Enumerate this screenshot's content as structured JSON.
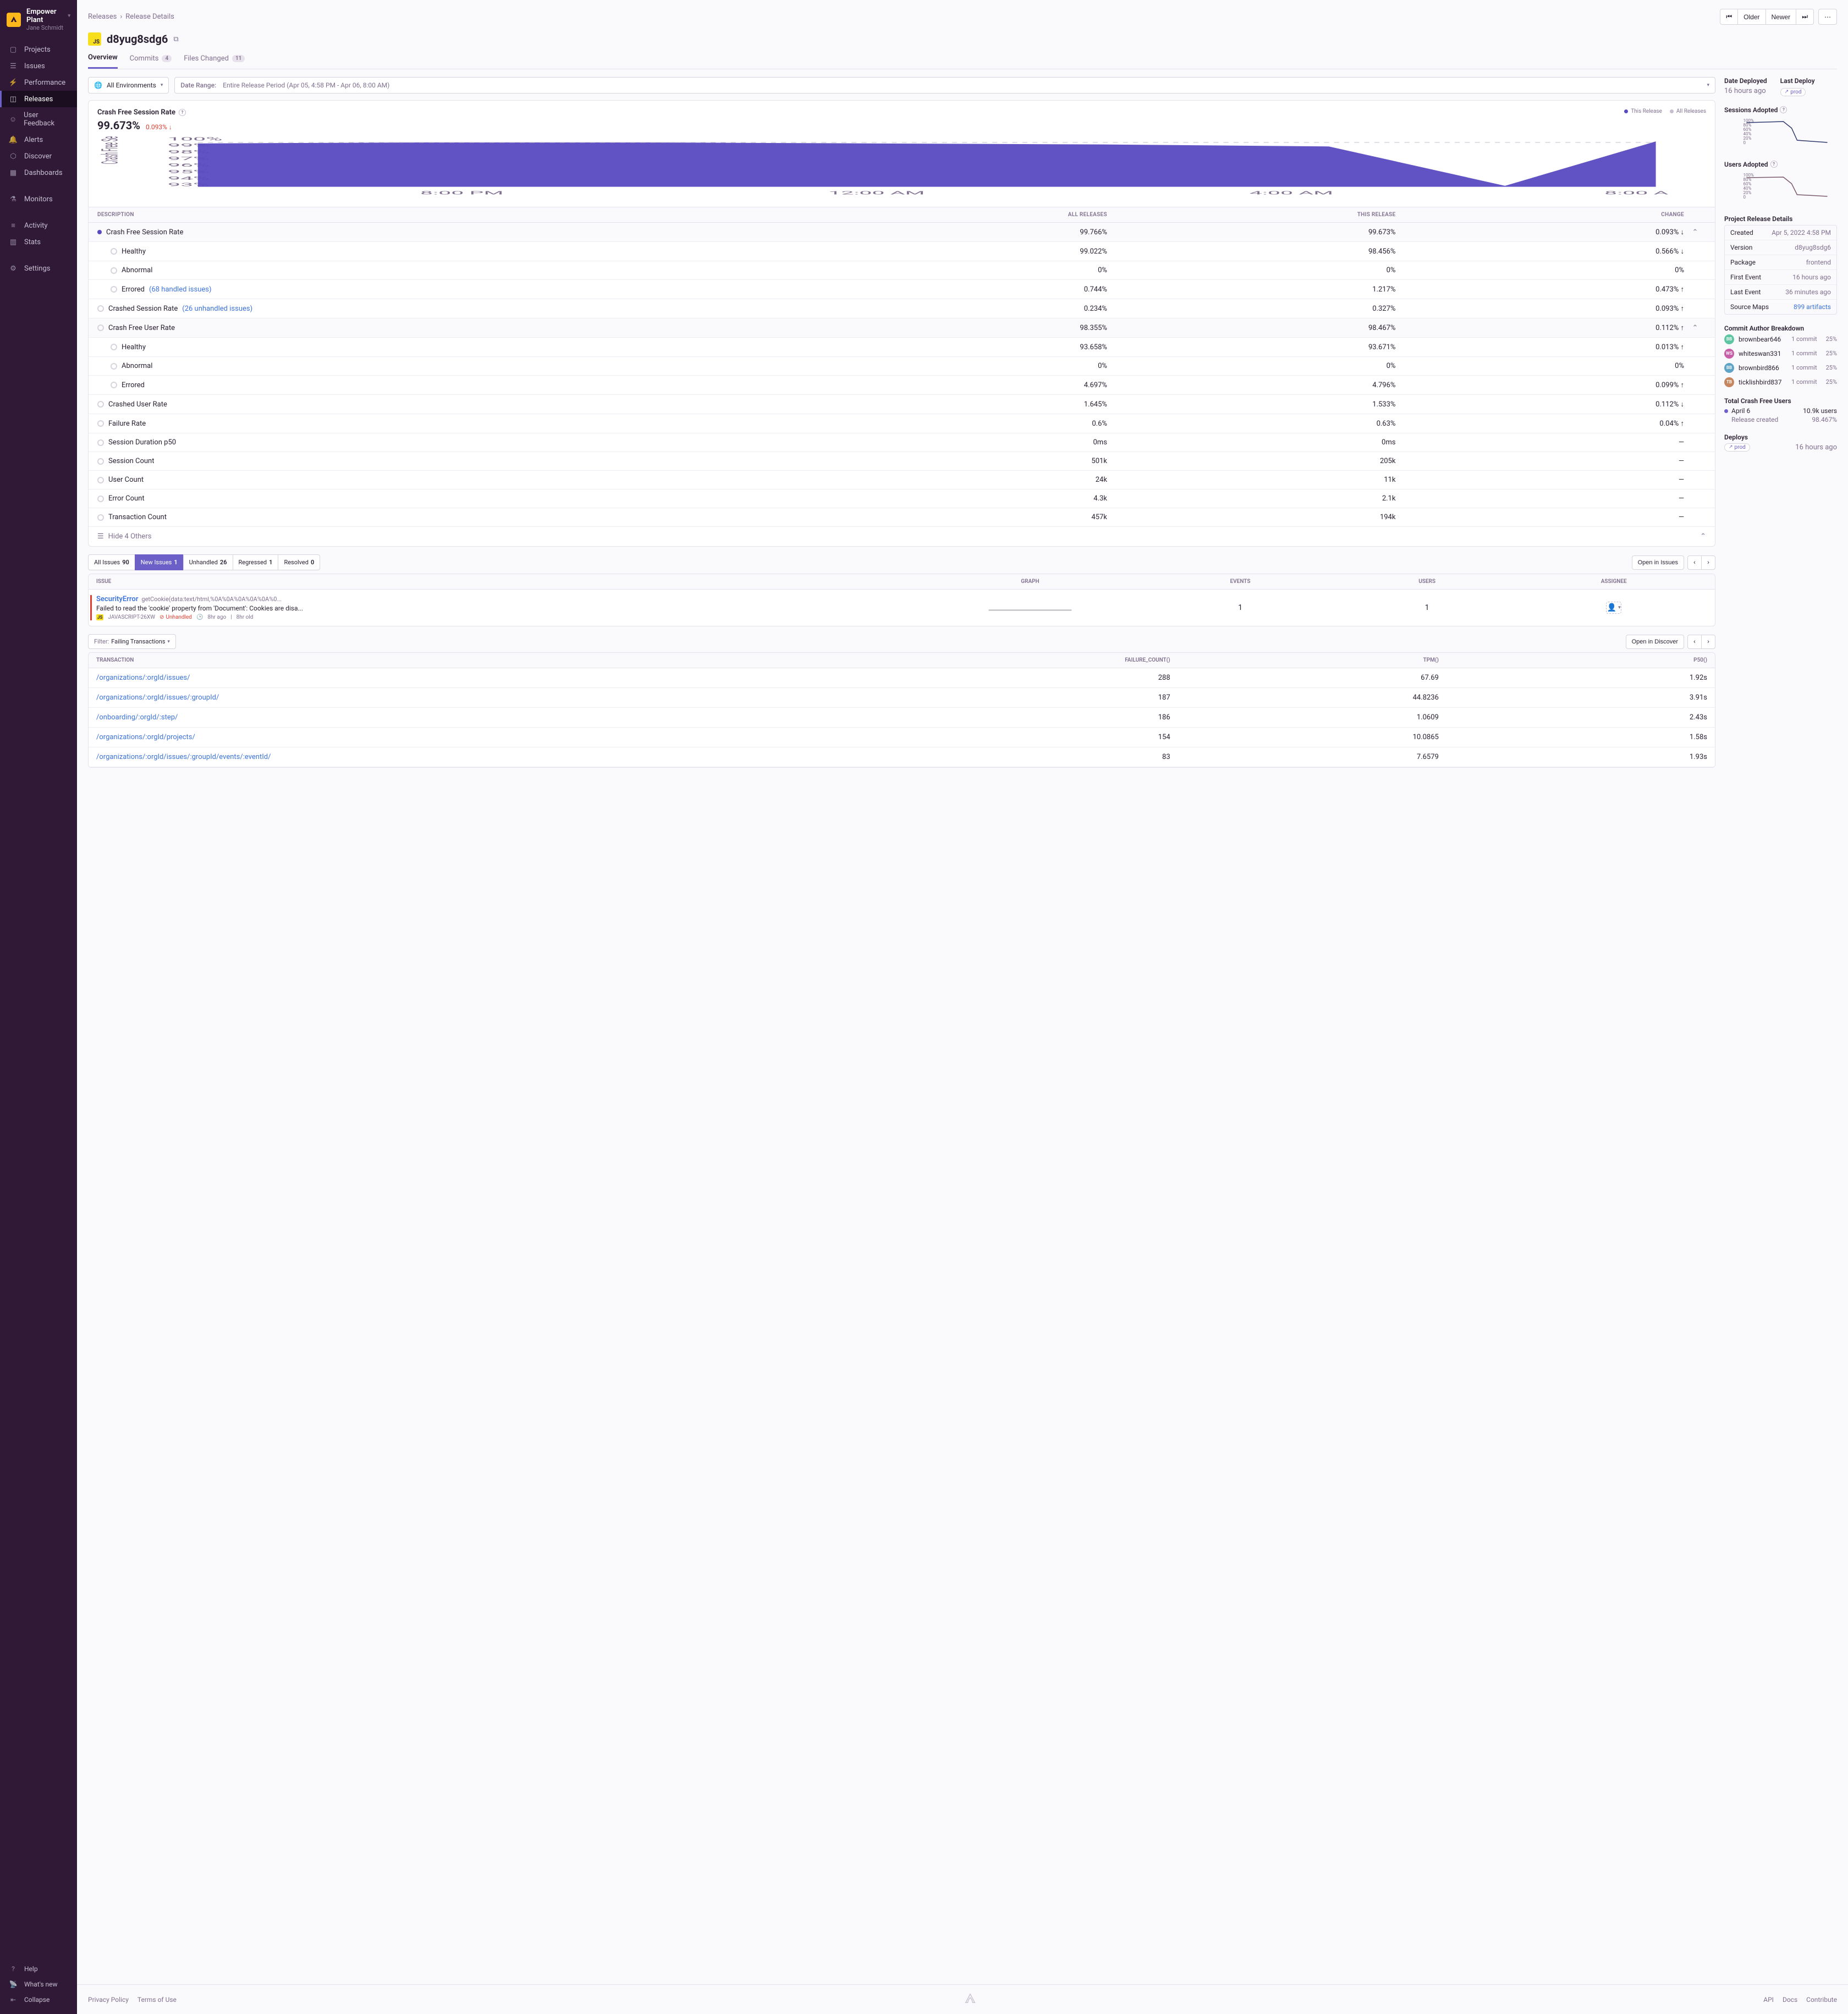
{
  "org": {
    "name": "Empower Plant",
    "user": "Jane Schmidt"
  },
  "nav": {
    "items": [
      "Projects",
      "Issues",
      "Performance",
      "Releases",
      "User Feedback",
      "Alerts",
      "Discover",
      "Dashboards"
    ],
    "items2": [
      "Monitors"
    ],
    "items3": [
      "Activity",
      "Stats"
    ],
    "items4": [
      "Settings"
    ],
    "footer": [
      "Help",
      "What's new",
      "Collapse"
    ]
  },
  "breadcrumbs": {
    "root": "Releases",
    "leaf": "Release Details"
  },
  "topButtons": {
    "older": "Older",
    "newer": "Newer"
  },
  "title": "d8yug8sdg6",
  "tabs": {
    "overview": "Overview",
    "commits": "Commits",
    "commits_n": "4",
    "files": "Files Changed",
    "files_n": "11"
  },
  "filters": {
    "env": "All Environments",
    "dateLabel": "Date Range:",
    "dateValue": "Entire Release Period (Apr 05, 4:58 PM - Apr 06, 8:00 AM)"
  },
  "crashChart": {
    "title": "Crash Free Session Rate",
    "pct": "99.673%",
    "delta": "0.093% ↓",
    "legend1": "This Release",
    "legend2": "All Releases"
  },
  "chart_data": {
    "type": "area",
    "title": "Crash Free Session Rate",
    "ylabel": "Crash Free Sessions",
    "ylim": [
      93,
      100
    ],
    "yticks": [
      100,
      99,
      98,
      97,
      96,
      95,
      94,
      93
    ],
    "xticks": [
      "8:00 PM",
      "12:00 AM",
      "4:00 AM",
      "8:00 A"
    ],
    "series": [
      {
        "name": "This Release",
        "color": "#584ac0",
        "values": [
          99.6,
          99.7,
          99.7,
          99.5,
          99.4,
          99.0,
          93.5,
          99.8
        ]
      },
      {
        "name": "All Releases",
        "color": "#c6becf",
        "values": [
          99.7,
          99.7,
          99.7,
          99.7,
          99.7,
          99.7,
          99.7,
          99.7
        ]
      }
    ]
  },
  "metricsHeader": {
    "desc": "DESCRIPTION",
    "all": "ALL RELEASES",
    "this": "THIS RELEASE",
    "change": "CHANGE"
  },
  "metrics": [
    {
      "name": "Crash Free Session Rate",
      "all": "99.766%",
      "this": "99.673%",
      "change": "0.093% ↓",
      "cls": "change-down",
      "head": true,
      "filled": true
    },
    {
      "name": "Healthy",
      "all": "99.022%",
      "this": "98.456%",
      "change": "0.566% ↓",
      "cls": "change-down",
      "indent": true
    },
    {
      "name": "Abnormal",
      "all": "0%",
      "this": "0%",
      "change": "0%",
      "cls": "change-neutral",
      "indent": true
    },
    {
      "name": "Errored",
      "link": "(68 handled issues)",
      "all": "0.744%",
      "this": "1.217%",
      "change": "0.473% ↑",
      "cls": "change-up",
      "indent": true
    },
    {
      "name": "Crashed Session Rate",
      "link": "(26 unhandled issues)",
      "all": "0.234%",
      "this": "0.327%",
      "change": "0.093% ↑",
      "cls": "change-up"
    },
    {
      "name": "Crash Free User Rate",
      "all": "98.355%",
      "this": "98.467%",
      "change": "0.112% ↑",
      "cls": "change-good",
      "head": true
    },
    {
      "name": "Healthy",
      "all": "93.658%",
      "this": "93.671%",
      "change": "0.013% ↑",
      "cls": "change-good",
      "indent": true
    },
    {
      "name": "Abnormal",
      "all": "0%",
      "this": "0%",
      "change": "0%",
      "cls": "change-neutral",
      "indent": true
    },
    {
      "name": "Errored",
      "all": "4.697%",
      "this": "4.796%",
      "change": "0.099% ↑",
      "cls": "change-up",
      "indent": true
    },
    {
      "name": "Crashed User Rate",
      "all": "1.645%",
      "this": "1.533%",
      "change": "0.112% ↓",
      "cls": "change-good"
    },
    {
      "name": "Failure Rate",
      "all": "0.6%",
      "this": "0.63%",
      "change": "0.04% ↑",
      "cls": "change-up"
    },
    {
      "name": "Session Duration p50",
      "all": "0ms",
      "this": "0ms",
      "change": "—",
      "cls": "change-neutral"
    },
    {
      "name": "Session Count",
      "all": "501k",
      "this": "205k",
      "change": "—",
      "cls": "change-neutral"
    },
    {
      "name": "User Count",
      "all": "24k",
      "this": "11k",
      "change": "—",
      "cls": "change-neutral"
    },
    {
      "name": "Error Count",
      "all": "4.3k",
      "this": "2.1k",
      "change": "—",
      "cls": "change-neutral"
    },
    {
      "name": "Transaction Count",
      "all": "457k",
      "this": "194k",
      "change": "—",
      "cls": "change-neutral"
    }
  ],
  "hideOthers": "Hide 4 Others",
  "issueTabs": {
    "all": {
      "label": "All Issues",
      "n": "90"
    },
    "new": {
      "label": "New Issues",
      "n": "1"
    },
    "unhandled": {
      "label": "Unhandled",
      "n": "26"
    },
    "regressed": {
      "label": "Regressed",
      "n": "1"
    },
    "resolved": {
      "label": "Resolved",
      "n": "0"
    }
  },
  "openInIssues": "Open in Issues",
  "issuesHeader": {
    "issue": "ISSUE",
    "graph": "GRAPH",
    "events": "EVENTS",
    "users": "USERS",
    "assignee": "ASSIGNEE"
  },
  "issue": {
    "name": "SecurityError",
    "culprit": "getCookie(data:text/html,%0A%0A%0A%0A%0A%0...",
    "msg": "Failed to read the 'cookie' property from 'Document': Cookies are disa...",
    "shortId": "JAVASCRIPT-26XW",
    "unhandled": "Unhandled",
    "age": "8hr ago",
    "firstSeen": "8hr old",
    "events": "1",
    "users": "1"
  },
  "txFilter": {
    "label": "Filter:",
    "value": "Failing Transactions"
  },
  "openInDiscover": "Open in Discover",
  "txHeader": {
    "tx": "TRANSACTION",
    "fc": "FAILURE_COUNT()",
    "tpm": "TPM()",
    "p50": "P50()"
  },
  "transactions": [
    {
      "name": "/organizations/:orgId/issues/",
      "fc": "288",
      "tpm": "67.69",
      "p50": "1.92s"
    },
    {
      "name": "/organizations/:orgId/issues/:groupId/",
      "fc": "187",
      "tpm": "44.8236",
      "p50": "3.91s"
    },
    {
      "name": "/onboarding/:orgId/:step/",
      "fc": "186",
      "tpm": "1.0609",
      "p50": "2.43s"
    },
    {
      "name": "/organizations/:orgId/projects/",
      "fc": "154",
      "tpm": "10.0865",
      "p50": "1.58s"
    },
    {
      "name": "/organizations/:orgId/issues/:groupId/events/:eventId/",
      "fc": "83",
      "tpm": "7.6579",
      "p50": "1.93s"
    }
  ],
  "side": {
    "dateDeployed": {
      "label": "Date Deployed",
      "value": "16 hours ago"
    },
    "lastDeploy": {
      "label": "Last Deploy",
      "value": "prod"
    },
    "sessionsLabel": "Sessions Adopted",
    "usersLabel": "Users Adopted",
    "miniTicks": [
      "100%",
      "80%",
      "60%",
      "40%",
      "20%",
      "0"
    ],
    "detailsTitle": "Project Release Details",
    "details": [
      {
        "k": "Created",
        "v": "Apr 5, 2022 4:58 PM"
      },
      {
        "k": "Version",
        "v": "d8yug8sdg6"
      },
      {
        "k": "Package",
        "v": "frontend"
      },
      {
        "k": "First Event",
        "v": "16 hours ago"
      },
      {
        "k": "Last Event",
        "v": "36 minutes ago"
      },
      {
        "k": "Source Maps",
        "v": "899 artifacts",
        "link": true
      }
    ],
    "commitsTitle": "Commit Author Breakdown",
    "authors": [
      {
        "initials": "BB",
        "color": "#5fc6a4",
        "name": "brownbear646",
        "commits": "1 commit",
        "pct": "25%"
      },
      {
        "initials": "WS",
        "color": "#c65fa8",
        "name": "whiteswan331",
        "commits": "1 commit",
        "pct": "25%"
      },
      {
        "initials": "BB",
        "color": "#5fa4c6",
        "name": "brownbird866",
        "commits": "1 commit",
        "pct": "25%"
      },
      {
        "initials": "TB",
        "color": "#c6865f",
        "name": "ticklishbird837",
        "commits": "1 commit",
        "pct": "25%"
      }
    ],
    "crashFreeTitle": "Total Crash Free Users",
    "crashFreeDate": "April 6",
    "crashFreeUsers": "10.9k users",
    "crashFreeNote": "Release created",
    "crashFreePct": "98.467%",
    "deploysTitle": "Deploys",
    "deployTime": "16 hours ago"
  },
  "footer": {
    "privacy": "Privacy Policy",
    "tou": "Terms of Use",
    "api": "API",
    "docs": "Docs",
    "contribute": "Contribute"
  }
}
